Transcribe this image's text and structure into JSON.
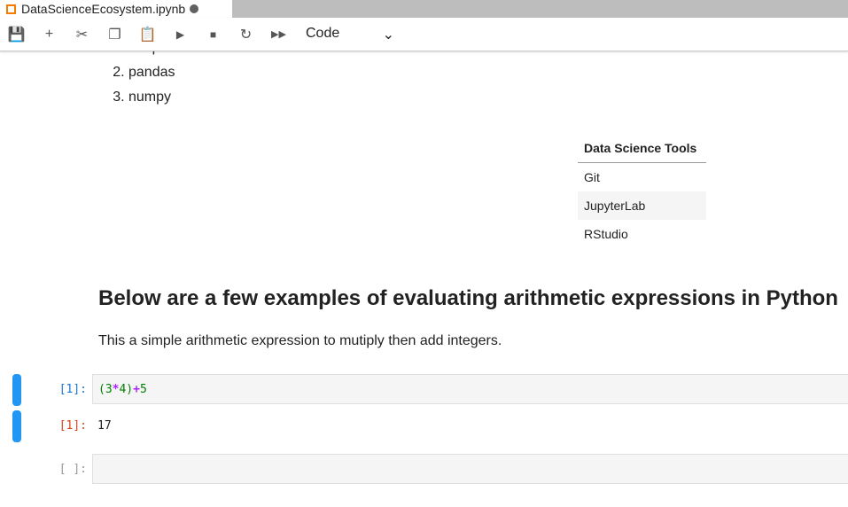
{
  "tab": {
    "title": "DataScienceEcosystem.ipynb"
  },
  "toolbar": {
    "cell_type": "Code"
  },
  "list": [
    "matplot",
    "pandas",
    "numpy"
  ],
  "table": {
    "header": "Data Science Tools",
    "rows": [
      "Git",
      "JupyterLab",
      "RStudio"
    ]
  },
  "heading": "Below are a few examples of evaluating arithmetic expressions in Python",
  "paragraph": "This a simple arithmetic expression to mutiply then add integers.",
  "cells": {
    "in_prompt": "[1]:",
    "code": {
      "p1": "(3",
      "op1": "*",
      "p2": "4)",
      "op2": "+",
      "p3": "5"
    },
    "out_prompt": "[1]:",
    "output": "17",
    "empty_prompt": "[ ]:"
  }
}
